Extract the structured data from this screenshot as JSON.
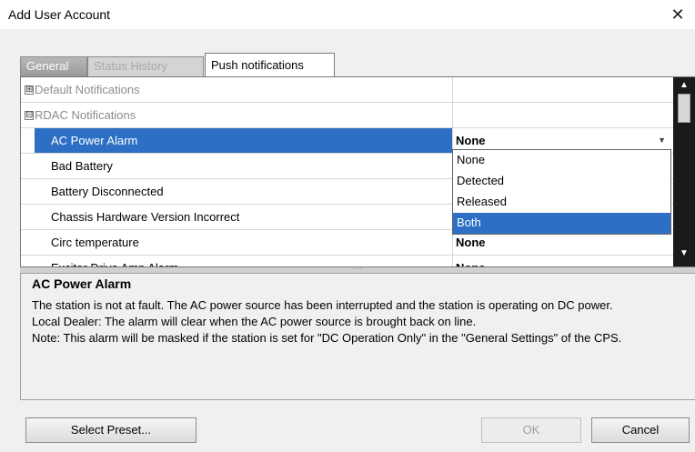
{
  "window": {
    "title": "Add User Account",
    "close_glyph": "✕"
  },
  "tabs": [
    {
      "label": "General",
      "state": "inactive"
    },
    {
      "label": "Status History",
      "state": "disabled"
    },
    {
      "label": "Push notifications",
      "state": "active"
    }
  ],
  "grid": {
    "rows": [
      {
        "type": "category",
        "expander": "⊞",
        "name": "Default Notifications",
        "value": ""
      },
      {
        "type": "category",
        "expander": "⊟",
        "name": "RDAC Notifications",
        "value": ""
      },
      {
        "type": "item",
        "selected": true,
        "name": "AC Power Alarm",
        "value": "None",
        "has_dropdown": true
      },
      {
        "type": "item",
        "name": "Bad Battery",
        "value": ""
      },
      {
        "type": "item",
        "name": "Battery Disconnected",
        "value": ""
      },
      {
        "type": "item",
        "name": "Chassis Hardware Version Incorrect",
        "value": ""
      },
      {
        "type": "item",
        "name": "Circ temperature",
        "value": "None"
      },
      {
        "type": "item",
        "name": "Excitor Drive Amp Alarm",
        "value": "None"
      }
    ],
    "dropdown_options": [
      "None",
      "Detected",
      "Released",
      "Both"
    ],
    "dropdown_highlighted": "Both"
  },
  "description": {
    "title": "AC Power Alarm",
    "lines": [
      "The station is not at fault. The AC power source has been interrupted and the station is operating on DC power.",
      "Local Dealer: The alarm will clear when the AC power source is brought back on line.",
      "Note: This alarm will be masked if the station is set for \"DC Operation Only\" in the \"General Settings\" of the CPS."
    ]
  },
  "buttons": {
    "preset": "Select Preset...",
    "ok": "OK",
    "cancel": "Cancel"
  },
  "colors": {
    "selection": "#2d6fc4",
    "scrollbar": "#1a1a1a"
  }
}
